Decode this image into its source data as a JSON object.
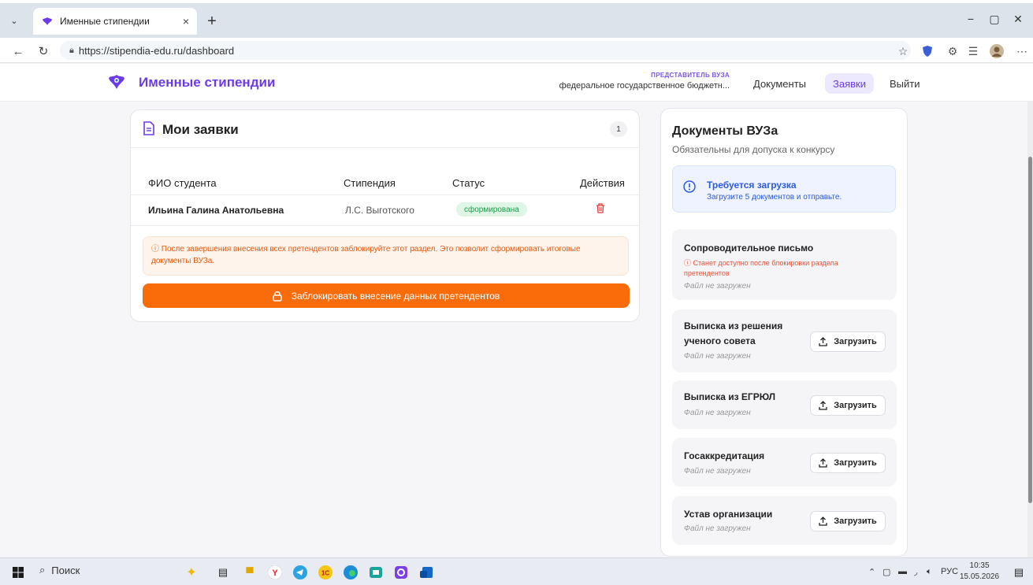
{
  "browser": {
    "tab_title": "Именные стипендии",
    "tab_close": "×",
    "new_tab": "+",
    "url": "https://stipendia-edu.ru/dashboard",
    "minimize": "−",
    "restore": "▢",
    "close": "✕"
  },
  "header": {
    "brand": "Именные стипендии",
    "role_label": "ПРЕДСТАВИТЕЛЬ ВУЗА",
    "org_name": "федеральное государственное бюджетн...",
    "nav": [
      "Документы",
      "Заявки",
      "Выйти"
    ],
    "active_nav": "Заявки"
  },
  "applications": {
    "title": "Мои заявки",
    "count": "1",
    "columns": [
      "ФИО студента",
      "Стипендия",
      "Статус",
      "Действия"
    ],
    "rows": [
      {
        "student": "Ильина Галина Анатольевна",
        "scholarship": "Л.С. Выготского",
        "status": "сформирована"
      }
    ],
    "warning": "После завершения внесения всех претендентов заблокируйте этот раздел. Это позволит сформировать итоговые документы ВУЗа.",
    "lock_button": "Заблокировать внесение данных претендентов"
  },
  "documents": {
    "title": "Документы ВУЗа",
    "subtitle": "Обязательны для допуска к конкурсу",
    "notice_title": "Требуется загрузка",
    "notice_text": "Загрузите 5 документов и отправьте.",
    "upload_label": "Загрузить",
    "items": [
      {
        "name": "Сопроводительное письмо",
        "note": "Станет доступно после блокировки раздела претендентов",
        "status": "Файл не загружен"
      },
      {
        "name": "Выписка из решения ученого совета",
        "status": "Файл не загружен"
      },
      {
        "name": "Выписка из ЕГРЮЛ",
        "status": "Файл не загружен"
      },
      {
        "name": "Госаккредитация",
        "status": "Файл не загружен"
      },
      {
        "name": "Устав организации",
        "status": "Файл не загружен"
      }
    ]
  },
  "taskbar": {
    "search": "Поиск",
    "lang": "РУС",
    "time": "10:35",
    "date": "15.05.2026"
  },
  "colors": {
    "brand": "#6c3be8",
    "accent_orange": "#fa6b0a",
    "status_green": "#1e9b4c",
    "info_blue": "#2b5be0"
  }
}
